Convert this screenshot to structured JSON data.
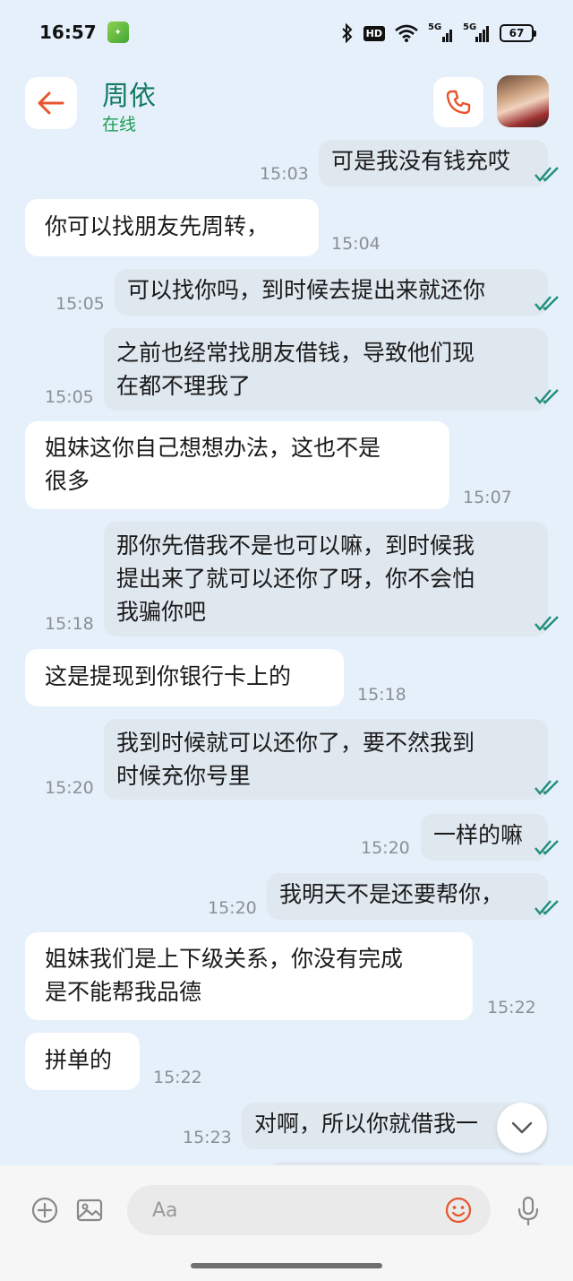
{
  "status_bar": {
    "time": "16:57",
    "network_1": "5G",
    "network_2": "5G",
    "hd": "HD",
    "battery": "67"
  },
  "header": {
    "contact_name": "周依",
    "contact_status": "在线"
  },
  "messages": [
    {
      "dir": "out",
      "text": [
        "可是我没有钱充哎"
      ],
      "time": "15:03"
    },
    {
      "dir": "in",
      "text": [
        "你可以找朋友先周转，"
      ],
      "time": "15:04"
    },
    {
      "dir": "out",
      "text": [
        "可以找你吗，到时候去提出来就还你"
      ],
      "time": "15:05"
    },
    {
      "dir": "out",
      "text": [
        "之前也经常找朋友借钱，导致他们现",
        "在都不理我了"
      ],
      "time": "15:05"
    },
    {
      "dir": "in",
      "text": [
        "姐妹这你自己想想办法，这也不是",
        "很多"
      ],
      "time": "15:07"
    },
    {
      "dir": "out",
      "text": [
        "那你先借我不是也可以嘛，到时候我",
        "提出来了就可以还你了呀，你不会怕",
        "我骗你吧"
      ],
      "time": "15:18"
    },
    {
      "dir": "in",
      "text": [
        "这是提现到你银行卡上的"
      ],
      "time": "15:18"
    },
    {
      "dir": "out",
      "text": [
        "我到时候就可以还你了，要不然我到",
        "时候充你号里"
      ],
      "time": "15:20"
    },
    {
      "dir": "out",
      "text": [
        "一样的嘛"
      ],
      "time": "15:20"
    },
    {
      "dir": "out",
      "text": [
        "我明天不是还要帮你，"
      ],
      "time": "15:20"
    },
    {
      "dir": "in",
      "text": [
        "姐妹我们是上下级关系，你没有完成",
        "是不能帮我品德"
      ],
      "time": "15:22"
    },
    {
      "dir": "in",
      "text": [
        "拼单的"
      ],
      "time": "15:22"
    },
    {
      "dir": "out",
      "text": [
        "对啊，所以你就借我一"
      ],
      "time": "15:23"
    }
  ],
  "input": {
    "placeholder": "Aa"
  },
  "colors": {
    "background": "#e6f0fb",
    "incoming_bubble": "#ffffff",
    "outgoing_bubble": "#dfe7ef",
    "accent_orange": "#e8542d",
    "name_green": "#127a62",
    "read_check": "#1f8f7a"
  }
}
